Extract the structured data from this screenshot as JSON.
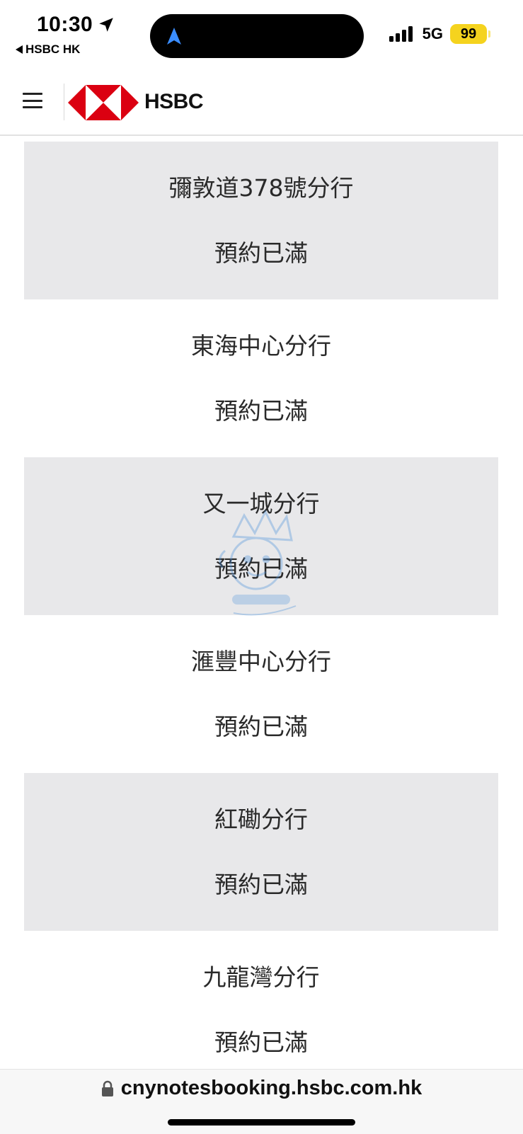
{
  "status_bar": {
    "time": "10:30",
    "back_app": "HSBC HK",
    "network": "5G",
    "battery": "99"
  },
  "header": {
    "brand": "HSBC",
    "menu_icon": "hamburger-menu-icon",
    "logo_colors": {
      "red": "#db0011",
      "white": "#ffffff"
    }
  },
  "branches": [
    {
      "name": "彌敦道378號分行",
      "status": "預約已滿"
    },
    {
      "name": "東海中心分行",
      "status": "預約已滿"
    },
    {
      "name": "又一城分行",
      "status": "預約已滿"
    },
    {
      "name": "滙豐中心分行",
      "status": "預約已滿"
    },
    {
      "name": "紅磡分行",
      "status": "預約已滿"
    },
    {
      "name": "九龍灣分行",
      "status": "預約已滿"
    }
  ],
  "url_bar": {
    "url": "cnynotesbooking.hsbc.com.hk"
  },
  "watermark": {
    "name": "親子王國",
    "name_en": "Baby Kingdom"
  }
}
